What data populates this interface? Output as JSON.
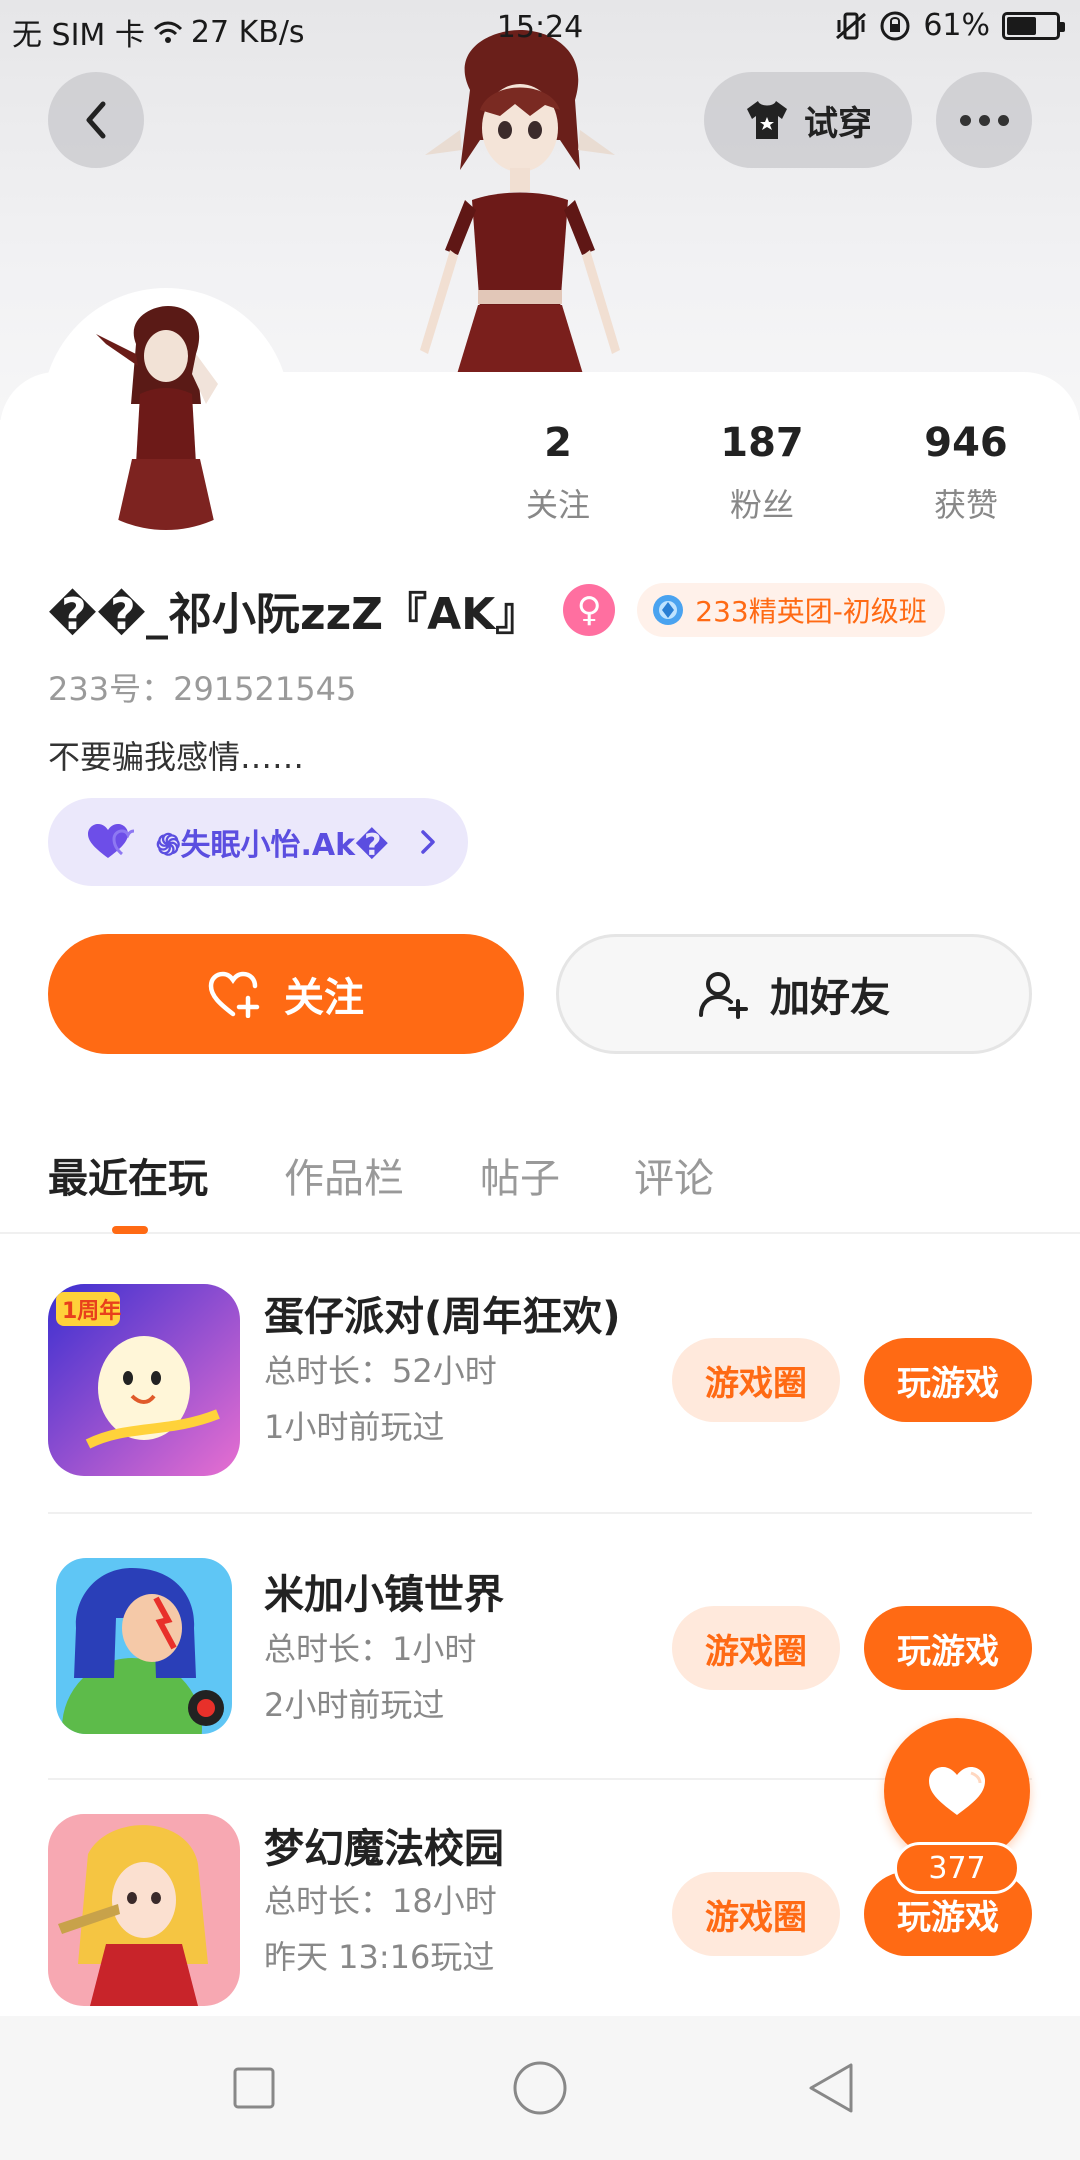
{
  "status_bar": {
    "carrier": "无 SIM 卡",
    "net_speed": "27 KB/s",
    "time": "15:24",
    "battery_percent": "61%",
    "battery_level": 0.61
  },
  "header": {
    "back_icon": "chevron-left-icon",
    "tryon_label": "试穿",
    "tryon_icon": "tshirt-icon",
    "more_icon": "more-dots-icon"
  },
  "profile": {
    "name": "��_祁小阮zzZ『AK』",
    "gender_icon": "female-icon",
    "gender_color": "#ff6fa0",
    "badge_label": "233精英团-初级班",
    "uid": "233号：291521545",
    "bio": "不要骗我感情……",
    "cp_label": "֍失眠小怡.Ak�",
    "stats": [
      {
        "value": "2",
        "label": "关注"
      },
      {
        "value": "187",
        "label": "粉丝"
      },
      {
        "value": "946",
        "label": "获赞"
      }
    ]
  },
  "actions": {
    "follow_label": "关注",
    "add_friend_label": "加好友"
  },
  "tabs": [
    {
      "label": "最近在玩",
      "active": true
    },
    {
      "label": "作品栏",
      "active": false
    },
    {
      "label": "帖子",
      "active": false
    },
    {
      "label": "评论",
      "active": false
    }
  ],
  "games": [
    {
      "title": "蛋仔派对(周年狂欢)",
      "duration": "总时长：52小时",
      "last_played": "1小时前玩过",
      "circle_label": "游戏圈",
      "play_label": "玩游戏"
    },
    {
      "title": "米加小镇世界",
      "duration": "总时长：1小时",
      "last_played": "2小时前玩过",
      "circle_label": "游戏圈",
      "play_label": "玩游戏"
    },
    {
      "title": "梦幻魔法校园",
      "duration": "总时长：18小时",
      "last_played": "昨天 13:16玩过",
      "circle_label": "游戏圈",
      "play_label": "玩游戏"
    }
  ],
  "like_fab": {
    "count": "377",
    "icon": "heart-icon"
  },
  "navbar": {
    "icons": [
      "square-icon",
      "circle-icon",
      "triangle-back-icon"
    ]
  },
  "colors": {
    "accent": "#ff6a14",
    "accent_light": "#ffe9dc",
    "cp_purple": "#5b4ee0"
  }
}
